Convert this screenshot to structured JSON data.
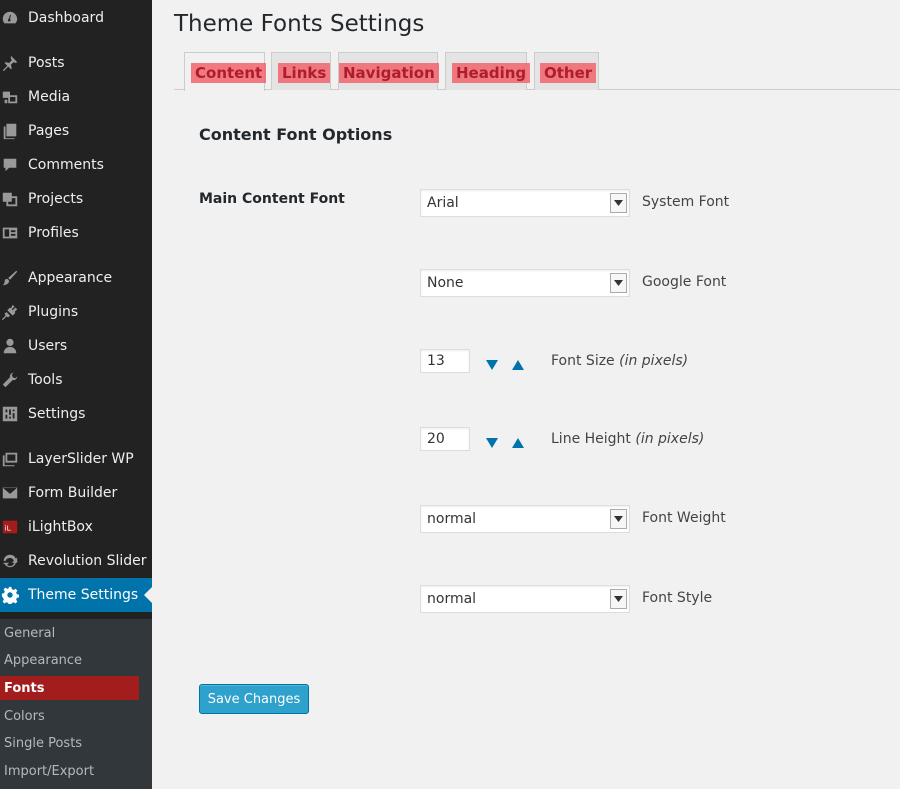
{
  "sidebar": {
    "items": [
      {
        "label": "Dashboard",
        "icon": "dashboard-icon"
      },
      {
        "label": "Posts",
        "icon": "pin-icon"
      },
      {
        "label": "Media",
        "icon": "media-icon"
      },
      {
        "label": "Pages",
        "icon": "pages-icon"
      },
      {
        "label": "Comments",
        "icon": "comment-icon"
      },
      {
        "label": "Projects",
        "icon": "projects-icon"
      },
      {
        "label": "Profiles",
        "icon": "profiles-icon"
      },
      {
        "label": "Appearance",
        "icon": "brush-icon"
      },
      {
        "label": "Plugins",
        "icon": "plug-icon"
      },
      {
        "label": "Users",
        "icon": "user-icon"
      },
      {
        "label": "Tools",
        "icon": "wrench-icon"
      },
      {
        "label": "Settings",
        "icon": "sliders-icon"
      },
      {
        "label": "LayerSlider WP",
        "icon": "layers-icon"
      },
      {
        "label": "Form Builder",
        "icon": "envelope-icon"
      },
      {
        "label": "iLightBox",
        "icon": "ilightbox-icon"
      },
      {
        "label": "Revolution Slider",
        "icon": "refresh-icon"
      },
      {
        "label": "Theme Settings",
        "icon": "gear-icon"
      }
    ],
    "submenu": [
      {
        "label": "General"
      },
      {
        "label": "Appearance"
      },
      {
        "label": "Fonts"
      },
      {
        "label": "Colors"
      },
      {
        "label": "Single Posts"
      },
      {
        "label": "Import/Export"
      }
    ]
  },
  "header": {
    "title": "Theme Fonts Settings"
  },
  "tabs": [
    {
      "label": "Content"
    },
    {
      "label": "Links"
    },
    {
      "label": "Navigation"
    },
    {
      "label": "Heading"
    },
    {
      "label": "Other"
    }
  ],
  "main": {
    "section_title": "Content Font Options",
    "field_label": "Main Content Font",
    "system_font": {
      "value": "Arial",
      "label": "System Font"
    },
    "google_font": {
      "value": "None",
      "label": "Google Font"
    },
    "font_size": {
      "value": "13",
      "label": "Font Size",
      "hint": "(in pixels)"
    },
    "line_height": {
      "value": "20",
      "label": "Line Height",
      "hint": "(in pixels)"
    },
    "font_weight": {
      "value": "normal",
      "label": "Font Weight"
    },
    "font_style": {
      "value": "normal",
      "label": "Font Style"
    },
    "save_label": "Save Changes"
  },
  "colors": {
    "sidebar_bg": "#222222",
    "active_menu": "#0073aa",
    "current_submenu": "#a31d1d",
    "tab_highlight": "#f0646e",
    "save_button": "#2ea2cc"
  }
}
